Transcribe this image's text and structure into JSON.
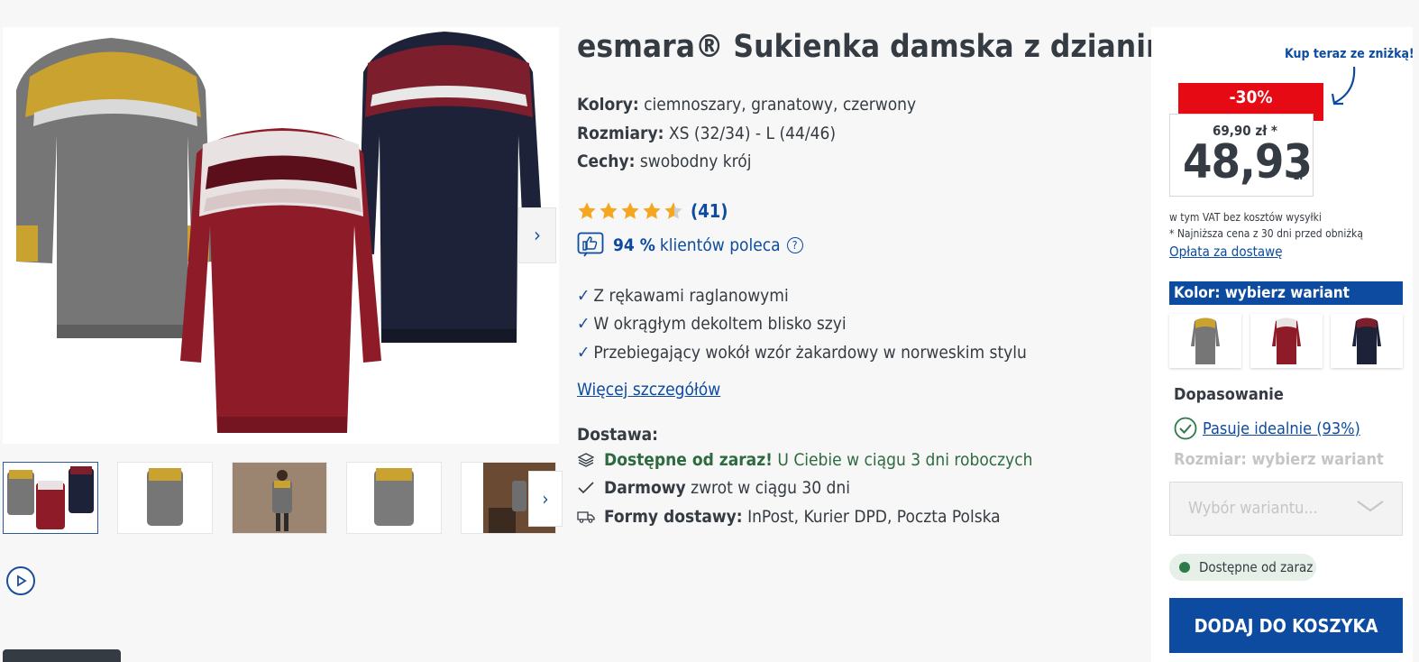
{
  "product": {
    "title": "esmara® Sukienka damska z dzianiny",
    "attributes": [
      {
        "label": "Kolory:",
        "value": "ciemnoszary, granatowy, czerwony"
      },
      {
        "label": "Rozmiary:",
        "value": "XS (32/34) - L (44/46)"
      },
      {
        "label": "Cechy:",
        "value": "swobodny krój"
      }
    ],
    "rating": {
      "value": 4.5,
      "max": 5,
      "count": "(41)"
    },
    "recommend": {
      "percent": "94 %",
      "text": "klientów poleca",
      "help": "?"
    },
    "features": [
      "Z rękawami raglanowymi",
      "W okrągłym dekoltem blisko szyi",
      "Przebiegający wokół wzór żakardowy w norweskim stylu"
    ],
    "more_link": "Więcej szczegółów",
    "delivery": {
      "title": "Dostawa:",
      "available_bold": "Dostępne od zaraz!",
      "available_rest": "U Ciebie w ciągu 3 dni roboczych",
      "return_bold": "Darmowy",
      "return_rest": "zwrot w ciągu 30 dni",
      "forms_bold": "Formy dostawy:",
      "forms_rest": "InPost, Kurier DPD, Poczta Polska"
    }
  },
  "gallery": {
    "next_arrow": "›",
    "thumb_next_arrow": "›"
  },
  "price": {
    "buy_now": "Kup teraz ze zniżką!",
    "discount": "-30%",
    "old_price": "69,90 zł *",
    "current": "48,93",
    "currency": "zł",
    "vat_note": "w tym VAT bez kosztów wysyłki",
    "lowest_note": "* Najniższa cena z 30 dni przed obniżką",
    "shipping_link": "Opłata za dostawę"
  },
  "variant": {
    "color_header": "Kolor: wybierz wariant",
    "fit_title": "Dopasowanie",
    "fit_link": "Pasuje idealnie (93%)",
    "size_label": "Rozmiar: wybierz wariant",
    "size_placeholder": "Wybór wariantu...",
    "availability": "Dostępne od zaraz",
    "add_to_cart": "DODAJ DO KOSZYKA"
  },
  "colors": {
    "accent": "#0d4ba0",
    "sale": "#e60a14",
    "grey_dress": "#6f6f6f",
    "red_dress": "#8e1b28",
    "navy_dress": "#1d2238",
    "mustard": "#c9a230"
  }
}
